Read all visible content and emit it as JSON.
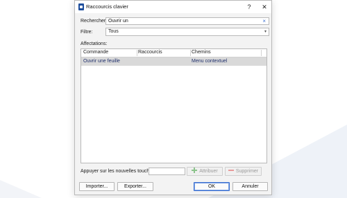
{
  "dialog": {
    "title": "Raccourcis clavier",
    "help_label": "?",
    "close_label": "✕"
  },
  "search": {
    "label": "Rechercher:",
    "value": "Ouvrir un",
    "clear_label": "×"
  },
  "filter": {
    "label": "Filtre:",
    "selected": "Tous"
  },
  "assignments": {
    "label": "Affectations:",
    "columns": [
      "Commande",
      "Raccourcis",
      "Chemins"
    ],
    "rows": [
      {
        "command": "Ouvrir une feuille",
        "shortcut": "",
        "path": "Menu contextuel"
      }
    ]
  },
  "new_keys": {
    "label": "Appuyer sur les nouvelles touches:",
    "value": ""
  },
  "buttons": {
    "assign": "Attribuer",
    "delete": "Supprimer",
    "import": "Importer...",
    "export": "Exporter...",
    "ok": "OK",
    "cancel": "Annuler"
  },
  "colors": {
    "accent": "#3b6fd0",
    "selected_row": "#d9d9d9",
    "row_text": "#1f2f6b"
  }
}
